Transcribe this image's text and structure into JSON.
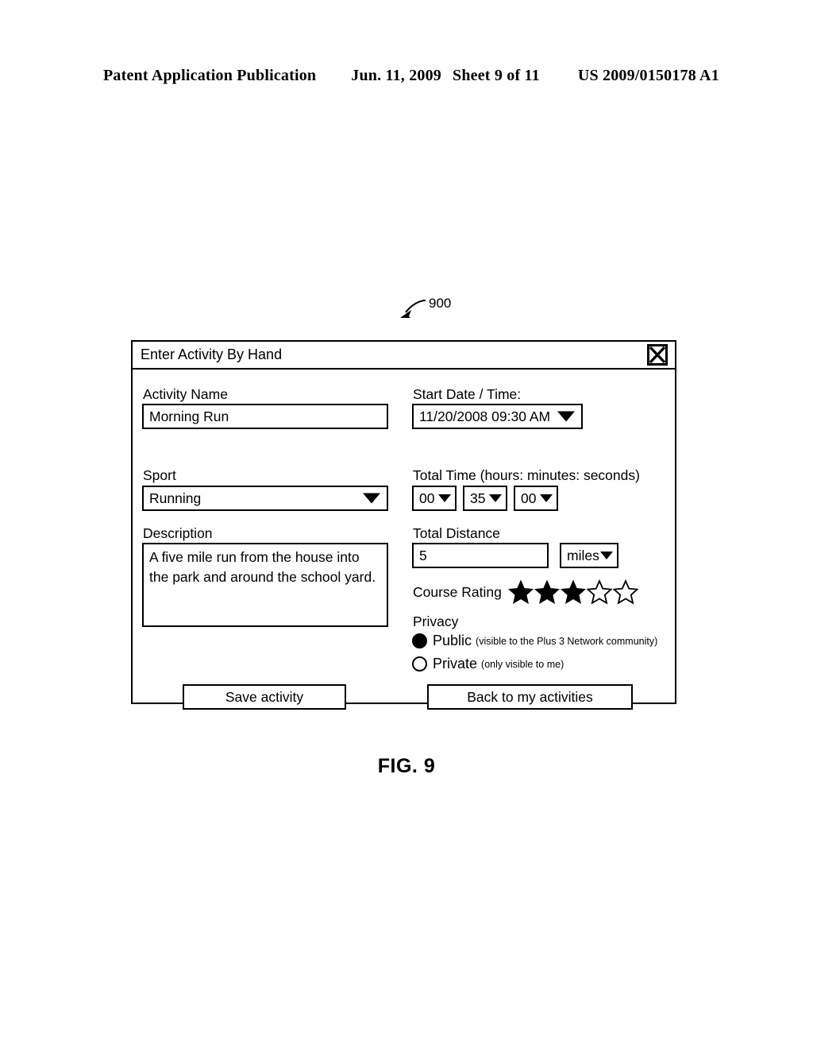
{
  "page_header": {
    "publication": "Patent Application Publication",
    "date": "Jun. 11, 2009",
    "sheet": "Sheet 9 of 11",
    "patent_number": "US 2009/0150178 A1"
  },
  "reference_numeral": "900",
  "figure_caption": "FIG. 9",
  "dialog": {
    "title": "Enter Activity By Hand",
    "close_icon": "close-x-icon",
    "left_column": {
      "activity_name": {
        "label": "Activity Name",
        "value": "Morning Run"
      },
      "sport": {
        "label": "Sport",
        "value": "Running",
        "caret_icon": "chevron-down-icon"
      },
      "description": {
        "label": "Description",
        "value": "A five mile run from the house into the park and around the school yard."
      }
    },
    "right_column": {
      "start_date_time": {
        "label": "Start Date / Time:",
        "value": "11/20/2008 09:30 AM",
        "caret_icon": "chevron-down-icon"
      },
      "total_time": {
        "label": "Total Time (hours: minutes: seconds)",
        "hours": "00",
        "minutes": "35",
        "seconds": "00"
      },
      "total_distance": {
        "label": "Total Distance",
        "value": "5",
        "unit": "miles",
        "caret_icon": "chevron-down-icon"
      },
      "course_rating": {
        "label": "Course Rating",
        "value": 3,
        "max": 5
      },
      "privacy": {
        "label": "Privacy",
        "options": [
          {
            "name": "Public",
            "note": "(visible to the Plus 3 Network community)",
            "selected": true
          },
          {
            "name": "Private",
            "note": "(only visible to me)",
            "selected": false
          }
        ]
      }
    },
    "buttons": {
      "save": "Save activity",
      "back": "Back to my activities"
    }
  },
  "colors": {
    "ink": "#000000",
    "paper": "#ffffff"
  }
}
